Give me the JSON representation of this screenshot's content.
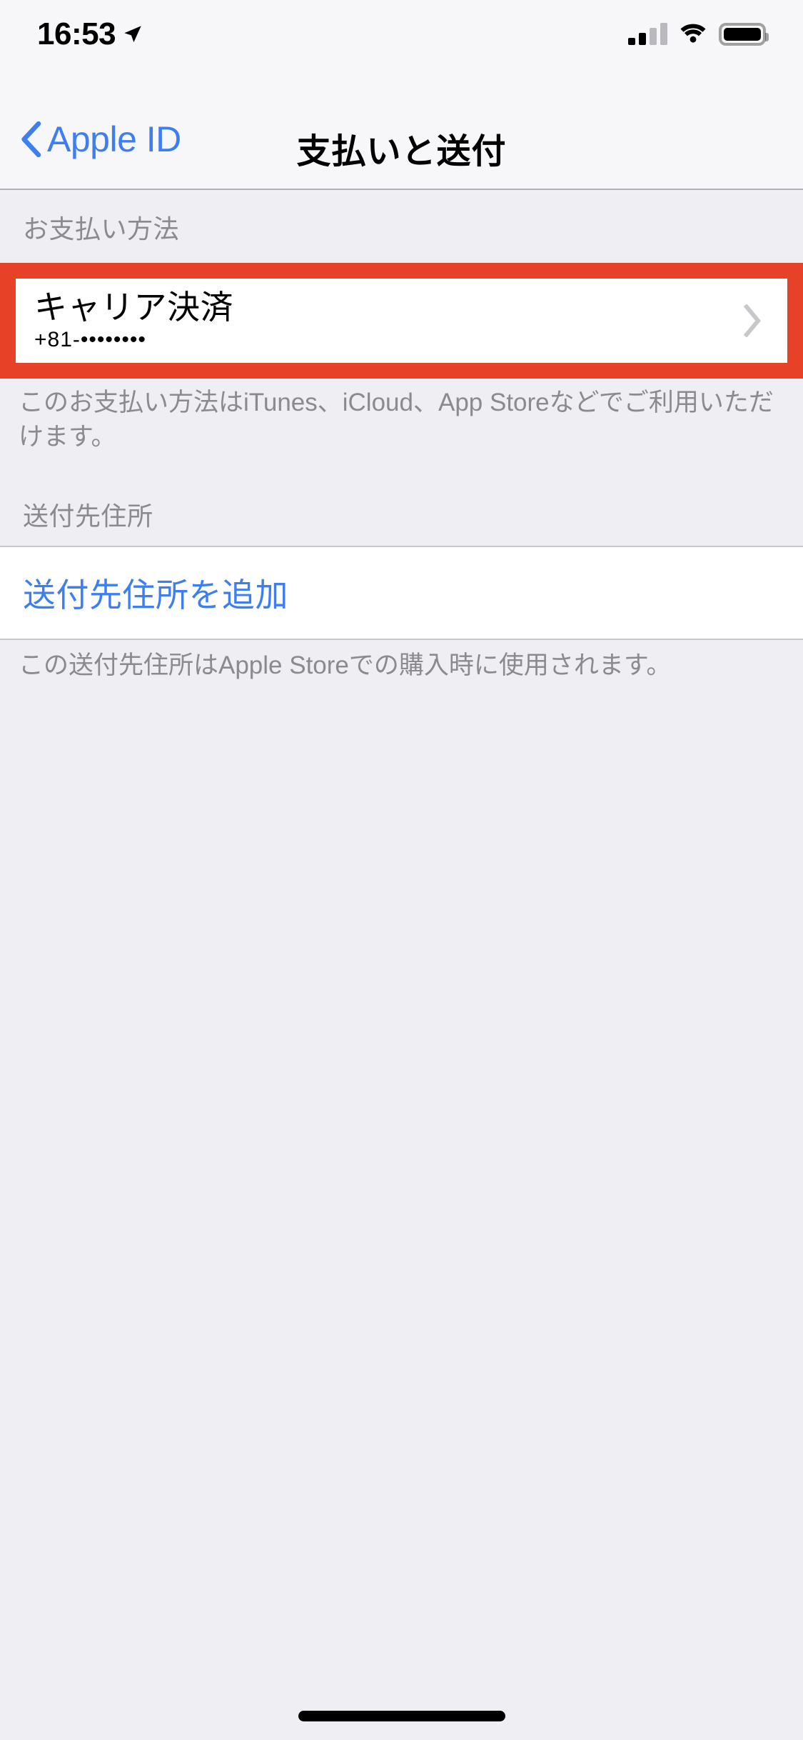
{
  "status_bar": {
    "time": "16:53",
    "location_icon": "location-arrow-icon",
    "cellular_icon": "cellular-signal-icon",
    "cellular_bars_filled": 2,
    "cellular_bars_total": 4,
    "wifi_icon": "wifi-icon",
    "battery_icon": "battery-full-icon",
    "battery_level_percent": 100
  },
  "nav_bar": {
    "back_label": "Apple ID",
    "back_icon": "chevron-left-icon",
    "title": "支払いと送付"
  },
  "payment_section": {
    "header": "お支払い方法",
    "row": {
      "title": "キャリア決済",
      "subtitle": "+81-••••••••",
      "disclosure_icon": "chevron-right-icon",
      "highlighted": true,
      "highlight_color": "#E74228"
    },
    "footer": "このお支払い方法はiTunes、iCloud、App Storeなどでご利用いただけます。"
  },
  "shipping_section": {
    "header": "送付先住所",
    "add_label": "送付先住所を追加",
    "footer": "この送付先住所はApple Storeでの購入時に使用されます。"
  },
  "home_indicator": {
    "name": "home-indicator"
  },
  "colors": {
    "accent_blue": "#3D7EF0",
    "highlight_red": "#E74228",
    "page_background": "#EFEEF3",
    "row_background": "#FFFFFF",
    "secondary_text": "#8A8A8F",
    "chevron_gray": "#C7C7CC"
  }
}
